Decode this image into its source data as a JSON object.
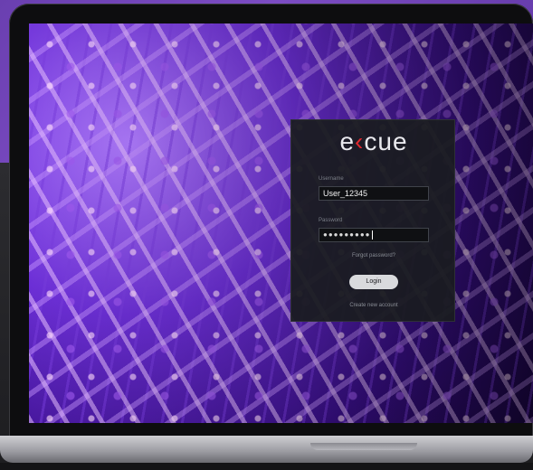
{
  "login": {
    "logo_prefix": "e",
    "logo_accent": "‹",
    "logo_suffix": "cue",
    "username_label": "Username",
    "username_value": "User_12345",
    "password_label": "Password",
    "password_value": "●●●●●●●●●",
    "forgot_link": "Forgot password?",
    "login_button": "Login",
    "create_link": "Create new account"
  },
  "colors": {
    "brand_accent": "#e0282e",
    "card_bg": "#1a1c20",
    "button_bg": "#d9dadd"
  }
}
